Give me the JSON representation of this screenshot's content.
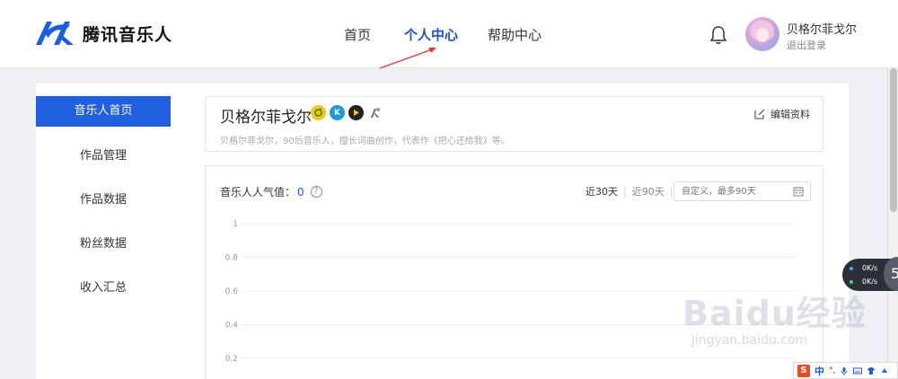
{
  "header": {
    "logo_text": "腾讯音乐人",
    "nav": [
      {
        "label": "首页",
        "active": false
      },
      {
        "label": "个人中心",
        "active": true
      },
      {
        "label": "帮助中心",
        "active": false
      }
    ],
    "username": "贝格尔菲戈尔",
    "logout_label": "退出登录"
  },
  "sidebar": {
    "items": [
      {
        "label": "音乐人首页",
        "active": true
      },
      {
        "label": "作品管理",
        "active": false
      },
      {
        "label": "作品数据",
        "active": false
      },
      {
        "label": "粉丝数据",
        "active": false
      },
      {
        "label": "收入汇总",
        "active": false
      }
    ]
  },
  "profile": {
    "name": "贝格尔菲戈尔",
    "edit_label": "编辑资料",
    "bio": "贝格尔菲戈尔，90后音乐人，擅长词曲创作，代表作《把心还给我》等。",
    "badge_icons": [
      "qq-music-icon",
      "kugou-icon",
      "kuwo-icon",
      "tme-icon"
    ]
  },
  "stats": {
    "title": "音乐人人气值：",
    "value": "0",
    "help_icon": "?",
    "range_30": "近30天",
    "range_90": "近90天",
    "date_placeholder": "自定义，最多90天"
  },
  "chart_data": {
    "type": "line",
    "y_ticks": [
      "1",
      "0.8",
      "0.6",
      "0.4",
      "0.2"
    ],
    "ylim": [
      0,
      1
    ],
    "grid": true,
    "series": []
  },
  "speed_widget": {
    "up": "0K/s",
    "down": "0K/s",
    "ball": "5"
  },
  "watermark": {
    "main": "Baidu经验",
    "sub": "jingyan.baidu.com"
  },
  "ime": {
    "s": "S",
    "zh": "中",
    "punct": "°,"
  },
  "colors": {
    "accent": "#1f5fe0",
    "logo_blue": "#1a5ee6",
    "arrow": "#e53935"
  }
}
